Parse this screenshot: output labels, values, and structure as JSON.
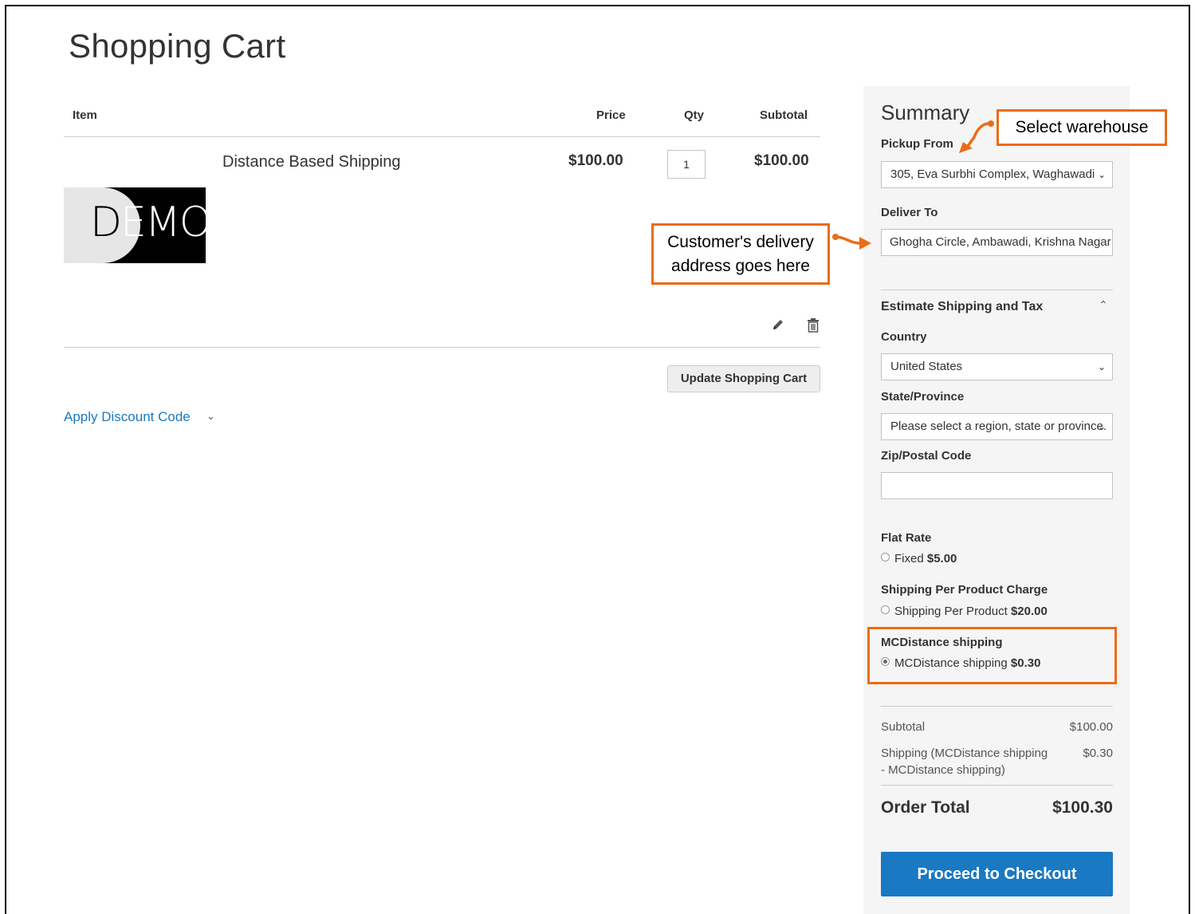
{
  "page": {
    "title": "Shopping Cart"
  },
  "cart": {
    "headers": {
      "item": "Item",
      "price": "Price",
      "qty": "Qty",
      "subtotal": "Subtotal"
    },
    "item": {
      "name": "Distance Based Shipping",
      "price": "$100.00",
      "qty": "1",
      "subtotal": "$100.00",
      "image_text": "DEMO"
    },
    "update_label": "Update Shopping Cart",
    "discount_label": "Apply Discount Code"
  },
  "summary": {
    "title": "Summary",
    "pickup_label": "Pickup From",
    "pickup_value": "305, Eva Surbhi Complex, Waghawadi",
    "deliver_label": "Deliver To",
    "deliver_value": "Ghogha Circle, Ambawadi, Krishna Nagar",
    "estimate_label": "Estimate Shipping and Tax",
    "country_label": "Country",
    "country_value": "United States",
    "state_label": "State/Province",
    "state_value": "Please select a region, state or province.",
    "zip_label": "Zip/Postal Code",
    "zip_value": "",
    "methods": [
      {
        "title": "Flat Rate",
        "option": "Fixed",
        "price": "$5.00",
        "selected": false
      },
      {
        "title": "Shipping Per Product Charge",
        "option": "Shipping Per Product",
        "price": "$20.00",
        "selected": false
      },
      {
        "title": "MCDistance shipping",
        "option": "MCDistance shipping",
        "price": "$0.30",
        "selected": true
      }
    ],
    "totals": {
      "subtotal_label": "Subtotal",
      "subtotal_value": "$100.00",
      "shipping_label_1": "Shipping (MCDistance shipping",
      "shipping_label_2": "- MCDistance shipping)",
      "shipping_value": "$0.30",
      "order_total_label": "Order Total",
      "order_total_value": "$100.30"
    },
    "checkout_label": "Proceed to Checkout"
  },
  "annotations": {
    "warehouse": "Select warehouse",
    "delivery_1": "Customer's delivery",
    "delivery_2": "address goes here"
  },
  "colors": {
    "annotation": "#eb6c16",
    "primary": "#1979c3",
    "summary_bg": "#f5f5f5"
  }
}
